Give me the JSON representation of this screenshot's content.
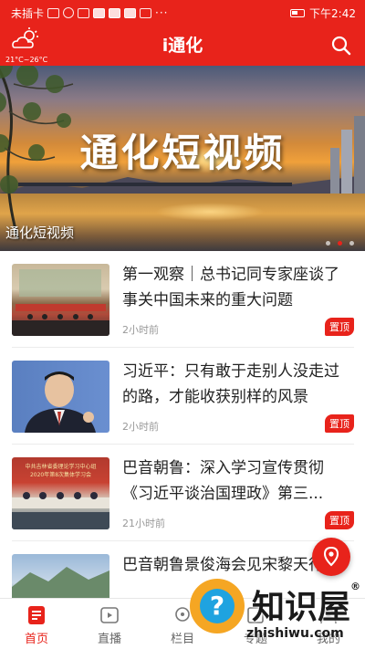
{
  "status_bar": {
    "carrier": "未插卡",
    "time": "下午2:42",
    "more": "···"
  },
  "header": {
    "title": "i通化",
    "temperature": "21°C~26°C",
    "weather_icon": "sun-cloud-icon",
    "search_icon": "search-icon"
  },
  "banner": {
    "overlay_text": "通化短视频",
    "caption": "通化短视频",
    "slide_count": 3,
    "active_slide": 2
  },
  "news": [
    {
      "headline": "第一观察｜总书记同专家座谈了事关中国未来的重大问题",
      "time": "2小时前",
      "badge": "置顶"
    },
    {
      "headline": "习近平：只有敢于走别人没走过的路，才能收获别样的风景",
      "time": "2小时前",
      "badge": "置顶"
    },
    {
      "headline": "巴音朝鲁：深入学习宣传贯彻《习近平谈治国理政》第三...",
      "time": "21小时前",
      "badge": "置顶"
    },
    {
      "headline": "巴音朝鲁景俊海会见宋黎天行",
      "time": "",
      "badge": ""
    }
  ],
  "thumbnail_text": {
    "item3": "中共吉林省委理论学习中心组 2020年第8次集体学习会"
  },
  "bottom_nav": [
    {
      "label": "首页",
      "icon": "news-icon",
      "active": true
    },
    {
      "label": "直播",
      "icon": "video-icon",
      "active": false
    },
    {
      "label": "栏目",
      "icon": "grid-icon",
      "active": false
    },
    {
      "label": "专题",
      "icon": "topic-icon",
      "active": false
    },
    {
      "label": "我的",
      "icon": "user-icon",
      "active": false
    }
  ],
  "watermark": {
    "name": "知识屋",
    "url": "zhishiwu.com",
    "mark": "®"
  },
  "colors": {
    "brand_red": "#e8231b",
    "text": "#222222",
    "muted": "#999999"
  }
}
